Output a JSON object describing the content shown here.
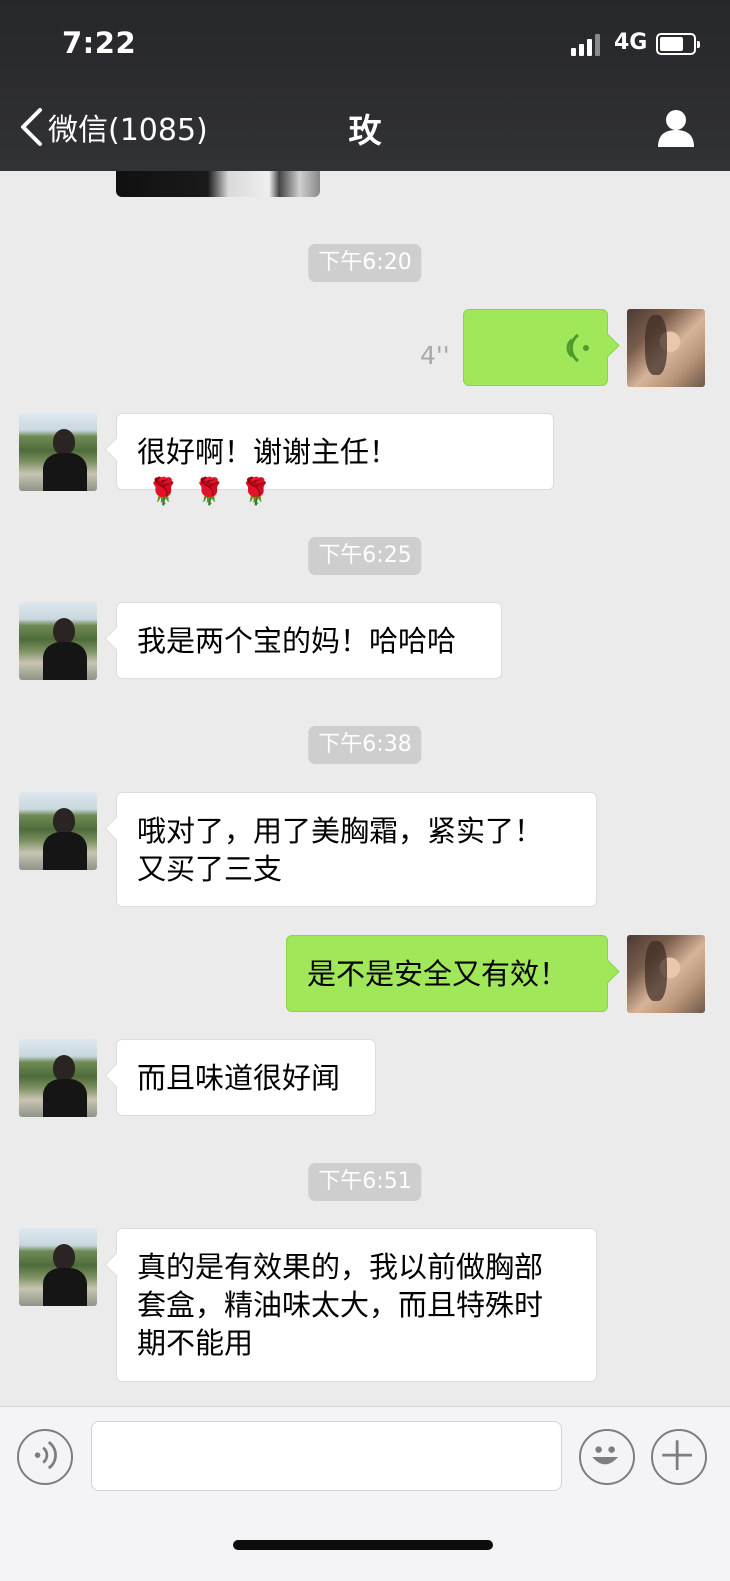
{
  "status_bar": {
    "time": "7:22",
    "network": "4G"
  },
  "nav": {
    "back_label": "微信(1085)",
    "title": "玫"
  },
  "messages": {
    "ts1": "下午6:20",
    "voice_duration": "4''",
    "m1": "很好啊！谢谢主任！",
    "m1_emoji": "🌹🌹🌹",
    "ts2": "下午6:25",
    "m2": "我是两个宝的妈！哈哈哈",
    "ts3": "下午6:38",
    "m3": "哦对了，用了美胸霜，紧实了！\n又买了三支",
    "m4": "是不是安全又有效！",
    "m5": "而且味道很好闻",
    "ts4": "下午6:51",
    "m6": "真的是有效果的，我以前做胸部\n套盒，精油味太大，而且特殊时\n期不能用"
  },
  "input_bar": {
    "text_value": ""
  },
  "icons": {
    "back": "chevron-left-icon",
    "profile": "person-icon",
    "voice": "voice-wave-icon",
    "emoji": "smiley-icon",
    "more": "plus-icon"
  },
  "colors": {
    "header_bg": "#2c2d31",
    "chat_bg": "#ebebeb",
    "my_bubble": "#a0e75a",
    "their_bubble": "#ffffff",
    "timestamp_bg": "#cecece"
  }
}
